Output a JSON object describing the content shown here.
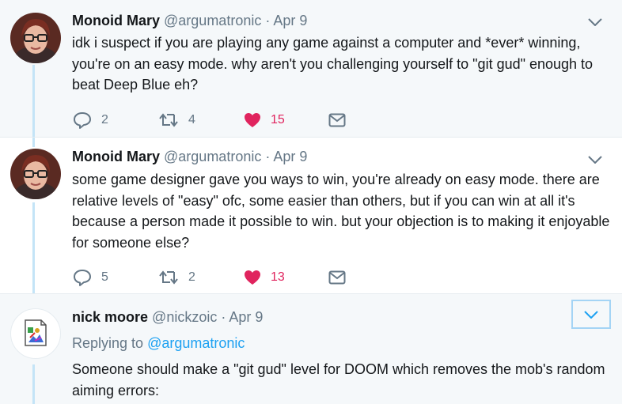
{
  "tweets": [
    {
      "name": "Monoid Mary",
      "handle": "@argumatronic",
      "sep": "·",
      "date": "Apr 9",
      "text": "idk i suspect if you are playing any game against a computer and *ever* winning, you're on an easy mode. why aren't you challenging yourself to \"git gud\" enough to beat Deep Blue eh?",
      "replies": "2",
      "retweets": "4",
      "likes": "15"
    },
    {
      "name": "Monoid Mary",
      "handle": "@argumatronic",
      "sep": "·",
      "date": "Apr 9",
      "text": "some game designer gave you ways to win, you're already on easy mode. there are relative levels of \"easy\" ofc, some easier than others, but if you can win at all it's because a person made it possible to win. but your objection is to making it enjoyable for someone else?",
      "replies": "5",
      "retweets": "2",
      "likes": "13"
    },
    {
      "name": "nick moore",
      "handle": "@nickzoic",
      "sep": "·",
      "date": "Apr 9",
      "replying_prefix": "Replying to ",
      "replying_to": "@argumatronic",
      "text": "Someone should make a \"git gud\" level for DOOM which removes the mob's random aiming errors:"
    }
  ],
  "colors": {
    "thread_line": "#c4e4f7",
    "like": "#e0245e",
    "link": "#1da1f2",
    "meta": "#657786"
  },
  "icons": [
    "reply-icon",
    "retweet-icon",
    "heart-icon",
    "mail-icon",
    "chevron-down-icon",
    "broken-image-icon"
  ]
}
